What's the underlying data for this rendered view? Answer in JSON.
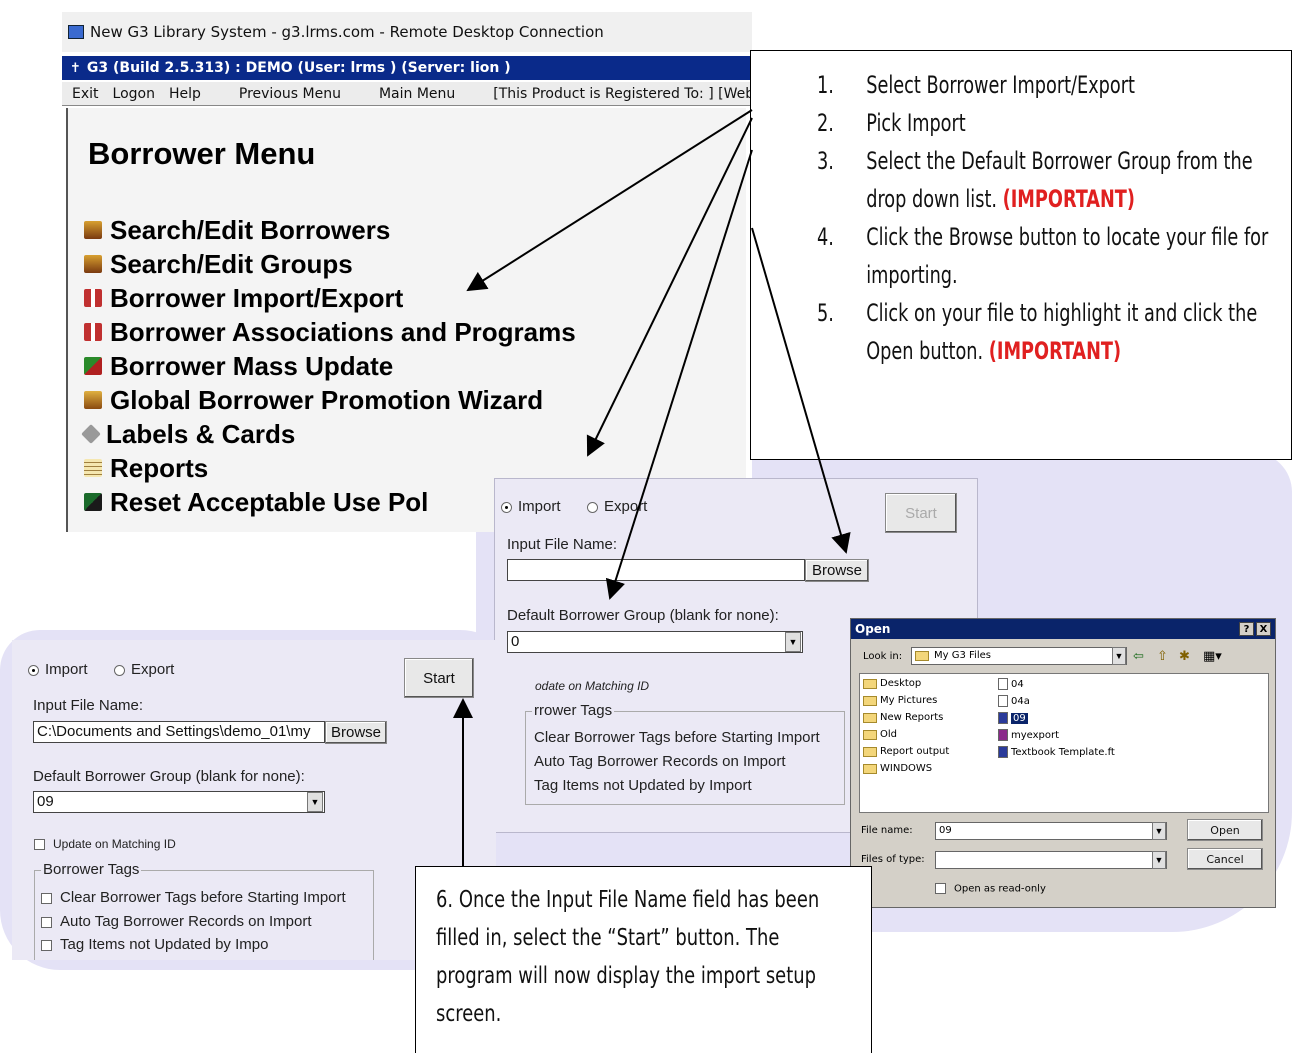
{
  "remote_window": {
    "title": "New G3 Library System - g3.lrms.com - Remote Desktop Connection",
    "app_title": "G3 (Build 2.5.313) : DEMO (User: lrms ) (Server: lion )",
    "menu": [
      "Exit",
      "Logon",
      "Help",
      "Previous Menu",
      "Main Menu",
      "[This Product is Registered To: ] [Web"
    ]
  },
  "borrower_menu": {
    "title": "Borrower Menu",
    "items": [
      {
        "label": "Search/Edit Borrowers",
        "icon": "people-icon"
      },
      {
        "label": "Search/Edit Groups",
        "icon": "people-icon"
      },
      {
        "label": "Borrower Import/Export",
        "icon": "gift-icon"
      },
      {
        "label": "Borrower Associations and Programs",
        "icon": "gift-icon"
      },
      {
        "label": "Borrower Mass Update",
        "icon": "grid-icon"
      },
      {
        "label": "Global Borrower Promotion Wizard",
        "icon": "people-icon"
      },
      {
        "label": "Labels & Cards",
        "icon": "tag-icon"
      },
      {
        "label": "Reports",
        "icon": "report-icon"
      },
      {
        "label": "Reset Acceptable Use Pol",
        "icon": "reset-icon"
      }
    ]
  },
  "instructions": {
    "steps": [
      {
        "num": "1.",
        "text": "Select Borrower Import/Export",
        "important": ""
      },
      {
        "num": "2.",
        "text": "Pick Import",
        "important": ""
      },
      {
        "num": "3.",
        "text": "Select the Default Borrower Group from the drop down list. ",
        "important": "(IMPORTANT)"
      },
      {
        "num": "4.",
        "text": "Click the Browse button to locate your file for importing.",
        "important": ""
      },
      {
        "num": "5.",
        "text": "Click on your file to highlight it and click the Open button. ",
        "important": "(IMPORTANT)"
      }
    ]
  },
  "import_dialog_mid": {
    "import_label": "Import",
    "export_label": "Export",
    "start_label": "Start",
    "input_file_label": "Input File Name:",
    "input_file_value": "",
    "browse_label": "Browse",
    "default_group_label": "Default Borrower Group (blank for none):",
    "default_group_value": "0",
    "update_label": "odate on Matching ID",
    "tags_title": "rrower Tags",
    "tags": [
      "Clear Borrower Tags before Starting Import",
      "Auto Tag Borrower Records on Import",
      "Tag Items not Updated by Import"
    ]
  },
  "import_dialog_left": {
    "import_label": "Import",
    "export_label": "Export",
    "start_label": "Start",
    "input_file_label": "Input File Name:",
    "input_file_value": "C:\\Documents and Settings\\demo_01\\my",
    "browse_label": "Browse",
    "default_group_label": "Default Borrower Group (blank for none):",
    "default_group_value": "09",
    "update_label": "Update on Matching ID",
    "tags_title": "Borrower Tags",
    "tags": [
      "Clear Borrower Tags before Starting Import",
      "Auto Tag Borrower Records on Import",
      "Tag Items not Updated by Impo"
    ]
  },
  "open_dialog": {
    "title": "Open",
    "look_in_label": "Look in:",
    "look_in_value": "My G3 Files",
    "folders": [
      "Desktop",
      "My Pictures",
      "New Reports",
      "Old",
      "Report output",
      "WINDOWS"
    ],
    "files": [
      "04",
      "04a",
      "09",
      "myexport",
      "Textbook Template.ft"
    ],
    "selected_file": "09",
    "file_name_label": "File name:",
    "file_name_value": "09",
    "files_of_type_label": "Files of type:",
    "files_of_type_value": "",
    "open_button": "Open",
    "cancel_button": "Cancel",
    "readonly_label": "Open as read-only",
    "help_glyph": "?",
    "close_glyph": "X"
  },
  "step6": {
    "text": "6. Once the Input File Name field has been filled in, select the “Start” button. The program will now display the import setup screen."
  },
  "colors": {
    "highlight_bg": "#e4e2f6",
    "title_blue": "#0a2a8a",
    "important_red": "#e02020"
  }
}
